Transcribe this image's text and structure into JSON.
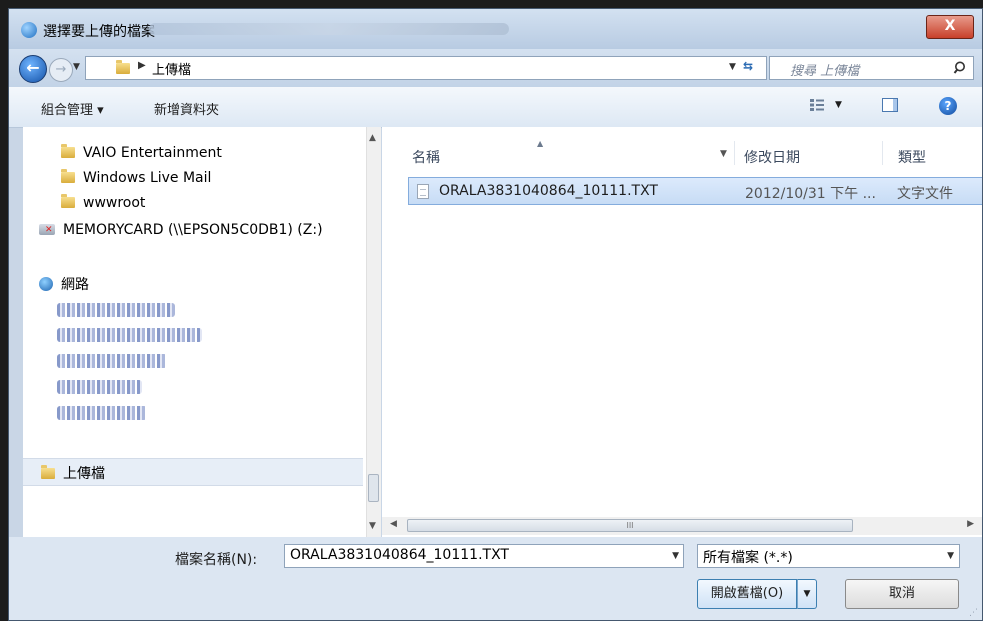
{
  "window": {
    "title": "選擇要上傳的檔案",
    "close_label": "X"
  },
  "nav": {
    "back_icon": "back-arrow-icon",
    "forward_icon": "forward-arrow-icon",
    "address_path": "上傳檔",
    "search_placeholder": "搜尋 上傳檔"
  },
  "toolbar": {
    "organize_label": "組合管理 ▾",
    "new_folder_label": "新增資料夾"
  },
  "sidebar": {
    "items": [
      {
        "label": "VAIO Entertainment",
        "icon": "folder-icon"
      },
      {
        "label": "Windows Live Mail",
        "icon": "folder-icon"
      },
      {
        "label": "wwwroot",
        "icon": "folder-icon"
      },
      {
        "label": "MEMORYCARD (\\\\EPSON5C0DB1) (Z:)",
        "icon": "network-drive-disconnected-icon"
      },
      {
        "label": "網路",
        "icon": "network-globe-icon"
      }
    ],
    "selected_label": "上傳檔"
  },
  "file_list": {
    "columns": {
      "name": "名稱",
      "modified": "修改日期",
      "type": "類型"
    },
    "rows": [
      {
        "name": "ORALA3831040864_10111.TXT",
        "modified": "2012/10/31 下午 ...",
        "type": "文字文件"
      }
    ],
    "hscroll_grip": "III"
  },
  "footer": {
    "filename_label": "檔案名稱(N):",
    "filename_value": "ORALA3831040864_10111.TXT",
    "filetype_value": "所有檔案 (*.*)",
    "open_label": "開啟舊檔(O)",
    "cancel_label": "取消"
  }
}
